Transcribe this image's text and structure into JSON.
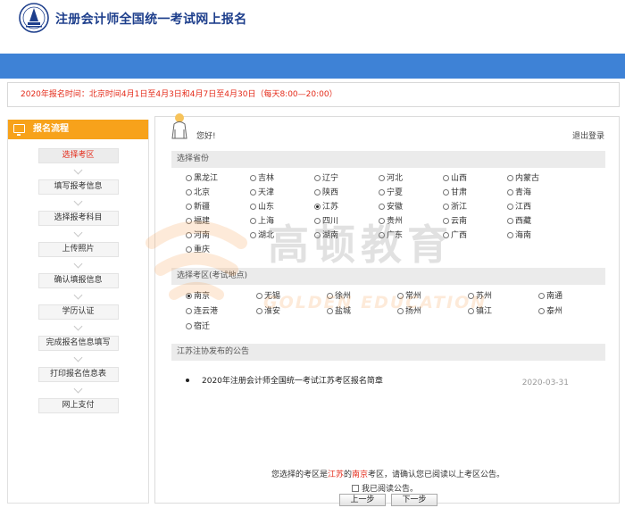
{
  "header": {
    "title": "注册会计师全国统一考试网上报名"
  },
  "notice": {
    "text": "2020年报名时间：北京时间4月1日至4月3日和4月7日至4月30日（每天8:00—20:00）"
  },
  "sidebar": {
    "title": "报名流程",
    "steps": [
      {
        "label": "选择考区",
        "active": true
      },
      {
        "label": "填写报考信息"
      },
      {
        "label": "选择报考科目"
      },
      {
        "label": "上传照片"
      },
      {
        "label": "确认填报信息"
      },
      {
        "label": "学历认证"
      },
      {
        "label": "完成报名信息填写"
      },
      {
        "label": "打印报名信息表"
      },
      {
        "label": "网上支付"
      }
    ]
  },
  "main": {
    "greeting": "您好!",
    "logout": "退出登录",
    "province_section_title": "选择省份",
    "provinces": [
      "黑龙江",
      "吉林",
      "辽宁",
      "河北",
      "山西",
      "内蒙古",
      "北京",
      "天津",
      "陕西",
      "宁夏",
      "甘肃",
      "青海",
      "新疆",
      "山东",
      "江苏",
      "安徽",
      "浙江",
      "江西",
      "福建",
      "上海",
      "四川",
      "贵州",
      "云南",
      "西藏",
      "河南",
      "湖北",
      "湖南",
      "广东",
      "广西",
      "海南",
      "重庆"
    ],
    "selected_province": "江苏",
    "area_section_title": "选择考区(考试地点)",
    "areas": [
      "南京",
      "无锡",
      "徐州",
      "常州",
      "苏州",
      "南通",
      "连云港",
      "淮安",
      "盐城",
      "扬州",
      "镇江",
      "泰州",
      "宿迁"
    ],
    "selected_area": "南京",
    "announcement_section_title": "江苏注协发布的公告",
    "announcement": {
      "title": "2020年注册会计师全国统一考试江苏考区报名简章",
      "date": "2020-03-31"
    },
    "selection_message": {
      "prefix": "您选择的考区是",
      "province": "江苏",
      "mid": "的",
      "area": "南京",
      "suffix": "考区，请确认您已阅读以上考区公告。"
    },
    "agree_label": "我已阅读公告。",
    "prev_button": "上一步",
    "next_button": "下一步"
  },
  "watermark": {
    "cn": "高顿教育",
    "en": "GOLDEN EDUCATION"
  },
  "colors": {
    "header_blue": "#3e82d6",
    "sidebar_orange": "#f7a21b",
    "alert_red": "#e42b1a",
    "title_navy": "#1e3f8c"
  }
}
